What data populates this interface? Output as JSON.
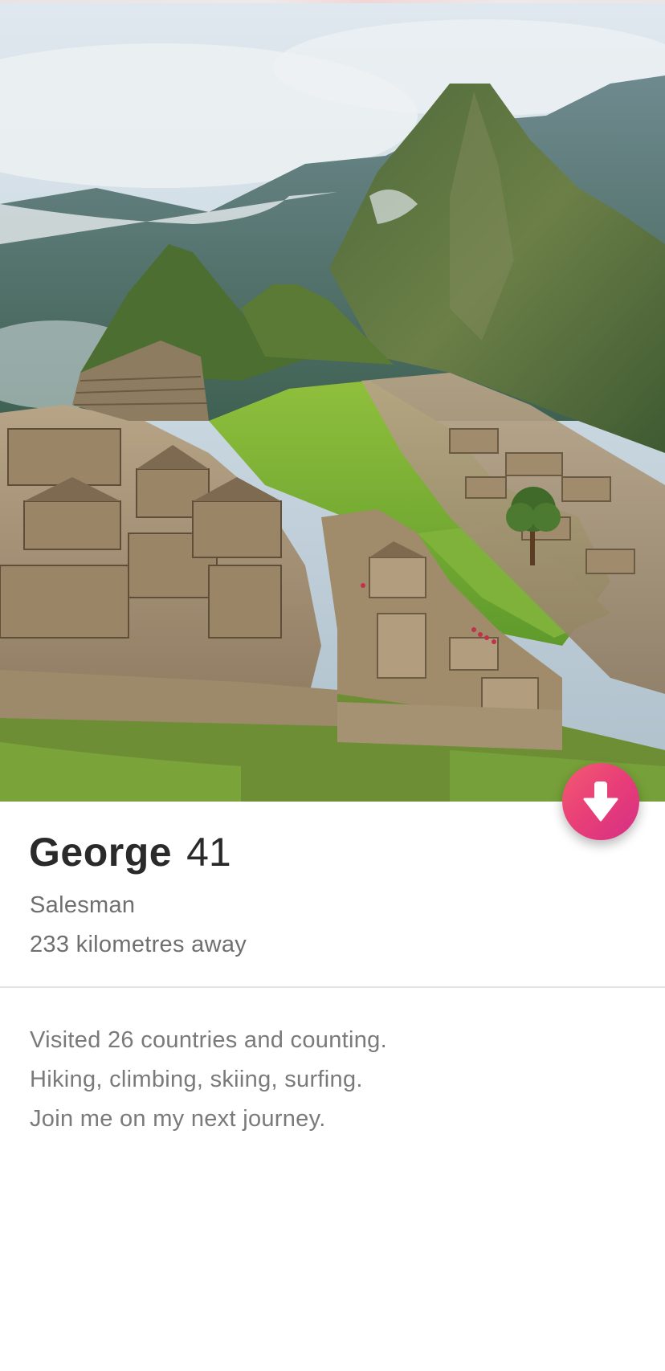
{
  "photo": {
    "description_icon": "mountain-ruins-photo"
  },
  "action_button": {
    "icon": "arrow-down-icon",
    "color_start": "#f25b72",
    "color_end": "#d52f84"
  },
  "profile": {
    "name": "George",
    "age": "41",
    "job": "Salesman",
    "distance": "233 kilometres away"
  },
  "bio": [
    "Visited 26 countries and counting.",
    "Hiking, climbing, skiing, surfing.",
    "Join me on my next journey."
  ]
}
